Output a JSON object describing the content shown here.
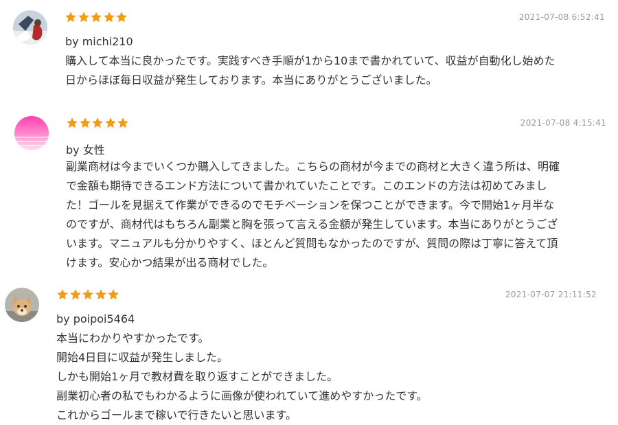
{
  "colors": {
    "star": "#f39c12",
    "date": "#999999",
    "text": "#333333"
  },
  "reviews": [
    {
      "avatar_icon": "user-photo-avatar",
      "rating": 5,
      "date": "2021-07-08 6:52:41",
      "author": "by michi210",
      "lines": [
        "購入して本当に良かったです。実践すべき手順が1から10まで書かれていて、収益が自動化し始めた",
        "日からほぼ毎日収益が発生しております。本当にありがとうございました。"
      ]
    },
    {
      "avatar_icon": "pink-gradient-avatar",
      "rating": 5,
      "date": "2021-07-08 4:15:41",
      "author": "by 女性",
      "lines": [
        "副業商材は今までいくつか購入してきました。こちらの商材が今までの商材と大きく違う所は、明確",
        "で金額も期待できるエンド方法について書かれていたことです。このエンドの方法は初めてみまし",
        "た！ゴールを見据えて作業ができるのでモチベーションを保つことができます。今で開始1ヶ月半な",
        "のですが、商材代はもちろん副業と胸を張って言える金額が発生しています。本当にありがとうござ",
        "います。マニュアルも分かりやすく、ほとんど質問もなかったのですが、質問の際は丁寧に答えて頂",
        "けます。安心かつ結果が出る商材でした。"
      ]
    },
    {
      "avatar_icon": "dog-photo-avatar",
      "rating": 5,
      "date": "2021-07-07 21:11:52",
      "author": "by poipoi5464",
      "lines": [
        "本当にわかりやすかったです。",
        "開始4日目に収益が発生しました。",
        "しかも開始1ヶ月で教材費を取り返すことができました。",
        "副業初心者の私でもわかるように画像が使われていて進めやすかったです。",
        "これからゴールまで稼いで行きたいと思います。"
      ]
    }
  ]
}
